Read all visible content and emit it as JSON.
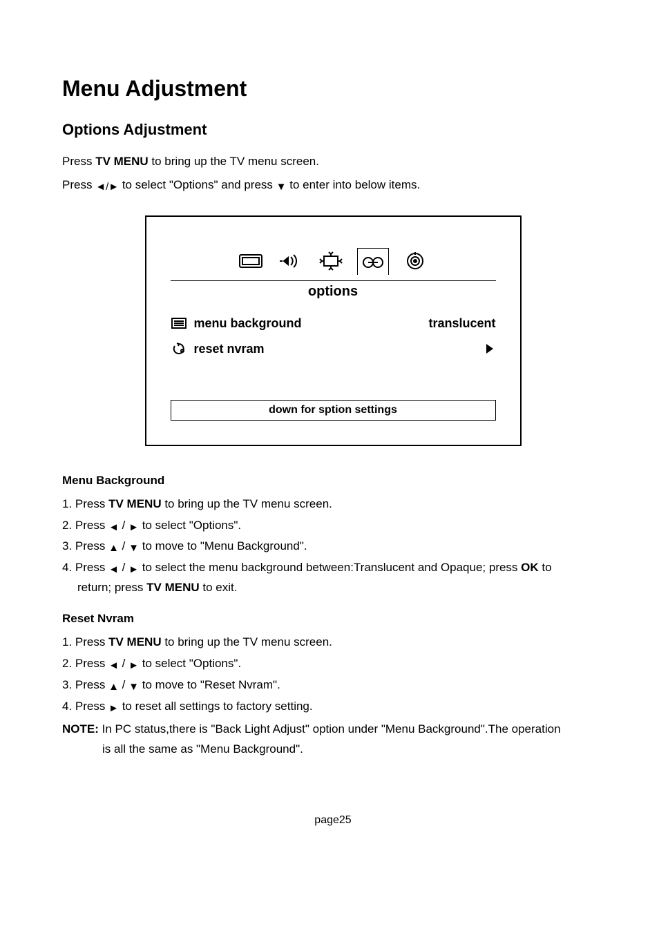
{
  "title": "Menu Adjustment",
  "subtitle": "Options Adjustment",
  "intro1_a": "Press  ",
  "intro1_key": "TV MENU",
  "intro1_b": "  to bring up the TV menu screen.",
  "intro2_a": "Press",
  "intro2_b": "to select \"Options\" and press",
  "intro2_c": "to enter into below items.",
  "osd": {
    "tab_label": "options",
    "row1_label": "menu background",
    "row1_value": "translucent",
    "row2_label": "reset nvram",
    "hint": "down for sption settings"
  },
  "sect_bg_head": "Menu Background",
  "bg_steps": {
    "s1a": "1. Press  ",
    "s1key": "TV MENU",
    "s1b": "  to bring up the TV menu screen.",
    "s2a": "2. Press",
    "s2b": "to select \"Options\".",
    "s3a": "3. Press",
    "s3b": "to move to \"Menu Background\".",
    "s4a": "4. Press",
    "s4b": "to select the menu background between:Translucent and Opaque; press  ",
    "s4ok": "OK",
    "s4c": "  to",
    "s4d": "return; press  ",
    "s4key": "TV MENU",
    "s4e": "  to exit."
  },
  "sect_nv_head": "Reset Nvram",
  "nv_steps": {
    "s1a": "1. Press  ",
    "s1key": "TV MENU",
    "s1b": "  to bring up the TV menu screen.",
    "s2a": "2. Press",
    "s2b": "to select \"Options\".",
    "s3a": "3. Press",
    "s3b": "to move to \"Reset Nvram\".",
    "s4a": "4. Press",
    "s4b": "to reset all settings to factory setting."
  },
  "note_label": "NOTE:",
  "note_a": " In PC status,there is \"Back Light Adjust\" option under \"Menu Background\".The operation",
  "note_b": "is all the same as \"Menu Background\".",
  "page_num": "page25",
  "glyphs": {
    "left": "◄",
    "right": "►",
    "up": "▲",
    "down": "▼",
    "slash": " / "
  }
}
